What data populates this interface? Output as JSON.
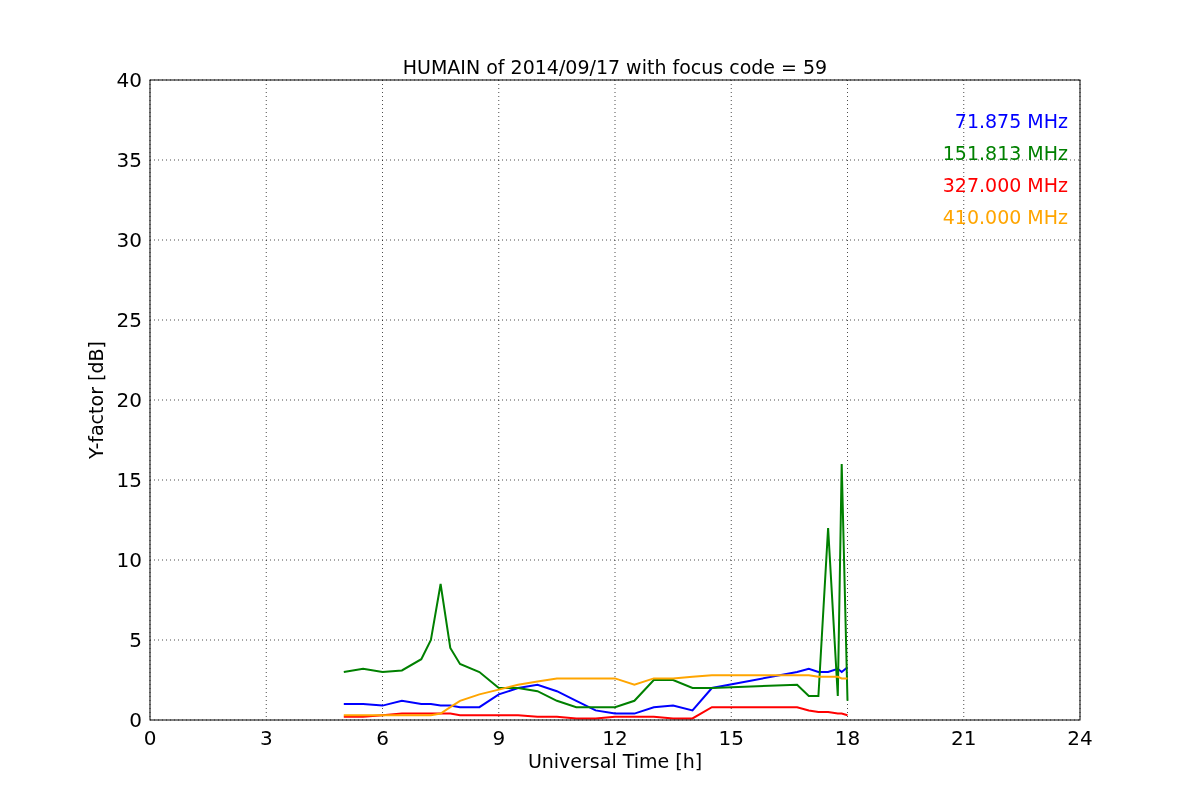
{
  "chart_data": {
    "type": "line",
    "title": "HUMAIN of 2014/09/17 with focus code = 59",
    "xlabel": "Universal Time [h]",
    "ylabel": "Y-factor [dB]",
    "x": [
      5,
      5.5,
      6,
      6.5,
      7,
      7.25,
      7.5,
      7.75,
      8,
      8.5,
      9,
      9.5,
      10,
      10.5,
      11,
      11.5,
      12,
      12.5,
      13,
      13.5,
      14,
      14.5,
      16.7,
      17,
      17.25,
      17.5,
      17.75,
      17.85,
      18
    ],
    "series": [
      {
        "name": "71.875 MHz",
        "color": "#0000ff",
        "values": [
          1.0,
          1.0,
          0.9,
          1.2,
          1.0,
          1.0,
          0.9,
          0.9,
          0.8,
          0.8,
          1.6,
          2.0,
          2.2,
          1.8,
          1.2,
          0.6,
          0.4,
          0.4,
          0.8,
          0.9,
          0.6,
          2.0,
          3.0,
          3.2,
          3.0,
          3.0,
          3.2,
          3.0,
          3.3
        ]
      },
      {
        "name": "151.813 MHz",
        "color": "#008000",
        "values": [
          3.0,
          3.2,
          3.0,
          3.1,
          3.8,
          5.0,
          8.5,
          4.5,
          3.5,
          3.0,
          2.0,
          2.0,
          1.8,
          1.2,
          0.8,
          0.8,
          0.8,
          1.2,
          2.5,
          2.5,
          2.0,
          2.0,
          2.2,
          1.5,
          1.5,
          12,
          1.5,
          16,
          1.2
        ]
      },
      {
        "name": "327.000 MHz",
        "color": "#ff0000",
        "values": [
          0.2,
          0.2,
          0.3,
          0.4,
          0.4,
          0.4,
          0.4,
          0.4,
          0.3,
          0.3,
          0.3,
          0.3,
          0.2,
          0.2,
          0.1,
          0.1,
          0.2,
          0.2,
          0.2,
          0.1,
          0.1,
          0.8,
          0.8,
          0.6,
          0.5,
          0.5,
          0.4,
          0.4,
          0.3
        ]
      },
      {
        "name": "410.000 MHz",
        "color": "#ffa500",
        "values": [
          0.3,
          0.3,
          0.3,
          0.3,
          0.3,
          0.3,
          0.4,
          0.8,
          1.2,
          1.6,
          1.9,
          2.2,
          2.4,
          2.6,
          2.6,
          2.6,
          2.6,
          2.2,
          2.6,
          2.6,
          2.7,
          2.8,
          2.8,
          2.8,
          2.7,
          2.7,
          2.7,
          2.6,
          2.6
        ]
      }
    ],
    "xlim": [
      0,
      24
    ],
    "ylim": [
      0,
      40
    ],
    "xticks": [
      0,
      3,
      6,
      9,
      12,
      15,
      18,
      21,
      24
    ],
    "yticks": [
      0,
      5,
      10,
      15,
      20,
      25,
      30,
      35,
      40
    ],
    "grid": true
  }
}
